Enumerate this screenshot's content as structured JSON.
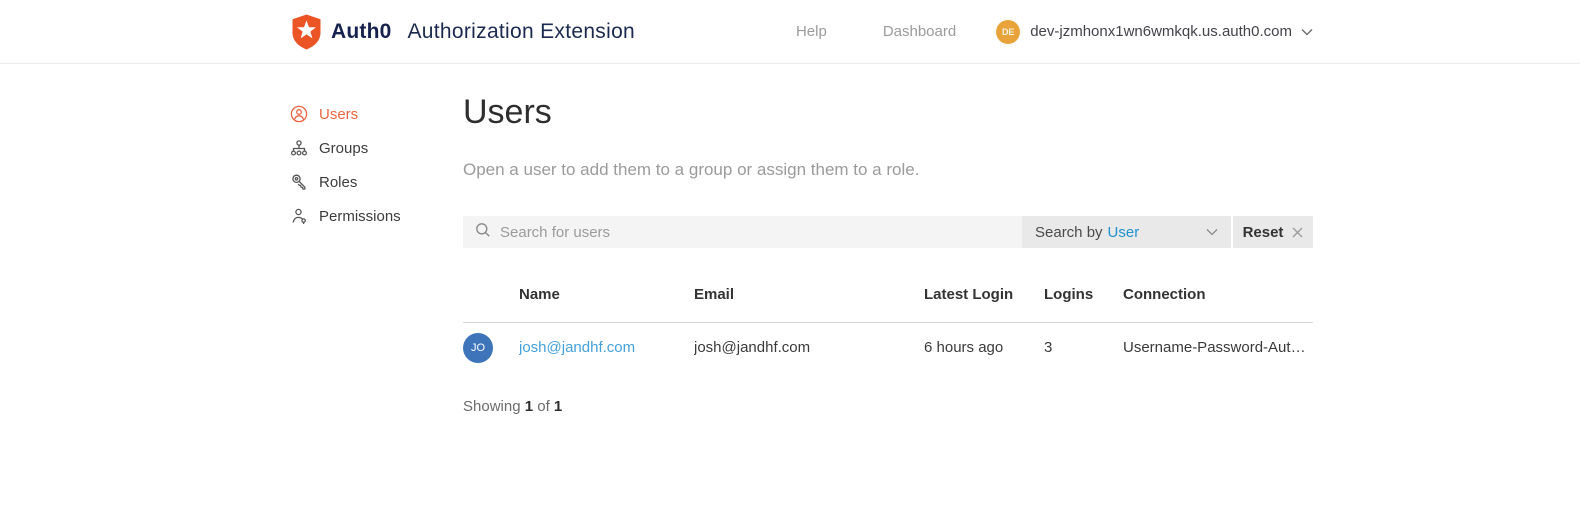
{
  "header": {
    "brand": "Auth0",
    "app_title": "Authorization Extension",
    "help_label": "Help",
    "dashboard_label": "Dashboard",
    "avatar_initials": "DE",
    "tenant": "dev-jzmhonx1wn6wmkqk.us.auth0.com"
  },
  "sidebar": {
    "items": [
      {
        "label": "Users",
        "icon": "user-circle-icon",
        "active": true
      },
      {
        "label": "Groups",
        "icon": "org-chart-icon",
        "active": false
      },
      {
        "label": "Roles",
        "icon": "key-icon",
        "active": false
      },
      {
        "label": "Permissions",
        "icon": "person-key-icon",
        "active": false
      }
    ]
  },
  "main": {
    "title": "Users",
    "description": "Open a user to add them to a group or assign them to a role.",
    "search": {
      "placeholder": "Search for users",
      "filter_prefix": "Search by",
      "filter_value": "User",
      "reset_label": "Reset"
    },
    "table": {
      "columns": [
        "Name",
        "Email",
        "Latest Login",
        "Logins",
        "Connection"
      ],
      "rows": [
        {
          "avatar_initials": "JO",
          "name": "josh@jandhf.com",
          "email": "josh@jandhf.com",
          "latest_login": "6 hours ago",
          "logins": "3",
          "connection": "Username-Password-Auth…"
        }
      ]
    },
    "footer": {
      "showing_label": "Showing",
      "current": "1",
      "of_label": "of",
      "total": "1"
    }
  },
  "colors": {
    "brand_orange": "#EB5424",
    "brand_navy": "#16214D",
    "active_orange": "#EB6542",
    "link_blue": "#45A1DA",
    "filter_blue": "#2192D0",
    "avatar_amber": "#E8A33B",
    "avatar_blue": "#3D74BA",
    "input_gray": "#F4F4F4",
    "control_gray": "#E9E9E9",
    "muted_text": "#9B9B9B"
  }
}
